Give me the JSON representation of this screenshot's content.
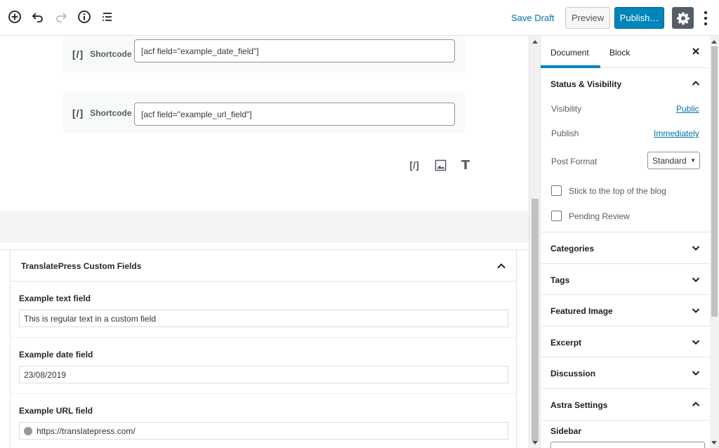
{
  "toolbar": {
    "icons": [
      "add-block-icon",
      "undo-icon",
      "redo-icon",
      "info-icon",
      "block-navigation-icon"
    ],
    "save_draft": "Save Draft",
    "preview": "Preview",
    "publish": "Publish…",
    "settings_icon": "gear-icon",
    "more_icon": "more-vertical-icon"
  },
  "editor": {
    "shortcode_blocks": [
      {
        "label": "Shortcode",
        "icon_text": "[/]",
        "value": "[acf field=\"example_date_field\"]"
      },
      {
        "label": "Shortcode",
        "icon_text": "[/]",
        "value": "[acf field=\"example_url_field\"]"
      }
    ],
    "inserter_icons": [
      "shortcode-icon",
      "image-icon",
      "heading-icon"
    ],
    "inserter_shortcode_text": "[/]",
    "inserter_heading_text": "T"
  },
  "metabox": {
    "title": "TranslatePress Custom Fields",
    "fields": [
      {
        "label": "Example text field",
        "value": "This is regular text in a custom field"
      },
      {
        "label": "Example date field",
        "value": "23/08/2019"
      },
      {
        "label": "Example URL field",
        "value": "https://translatepress.com/"
      }
    ]
  },
  "sidebar": {
    "tabs": [
      "Document",
      "Block"
    ],
    "active_tab": "Document",
    "status": {
      "title": "Status & Visibility",
      "visibility_label": "Visibility",
      "visibility_value": "Public",
      "publish_label": "Publish",
      "publish_value": "Immediately",
      "format_label": "Post Format",
      "format_value": "Standard",
      "sticky_label": "Stick to the top of the blog",
      "pending_label": "Pending Review"
    },
    "panels": [
      "Categories",
      "Tags",
      "Featured Image",
      "Excerpt",
      "Discussion"
    ],
    "astra": {
      "title": "Astra Settings",
      "sidebar_label": "Sidebar"
    }
  },
  "colors": {
    "accent": "#0085ba",
    "link": "#0073aa",
    "settings_bg": "#555d66"
  }
}
